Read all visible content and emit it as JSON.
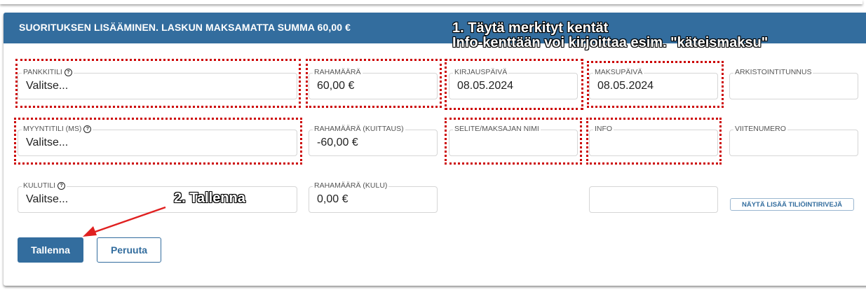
{
  "header": {
    "title": "SUORITUKSEN LISÄÄMINEN. LASKUN MAKSAMATTA SUMMA 60,00 €"
  },
  "annotations": {
    "step1_line1": "1. Täytä merkityt kentät",
    "step1_line2": "Info-kenttään voi kirjoittaa esim. \"käteismaksu\"",
    "step2": "2. Tallenna"
  },
  "fields": {
    "pankkitili": {
      "label": "PANKKITILI",
      "value": "Valitse..."
    },
    "rahamaara": {
      "label": "RAHAMÄÄRÄ",
      "value": "60,00 €"
    },
    "kirjauspaiva": {
      "label": "KIRJAUSPÄIVÄ",
      "value": "08.05.2024"
    },
    "maksupaiva": {
      "label": "MAKSUPÄIVÄ",
      "value": "08.05.2024"
    },
    "arkistointitunnus": {
      "label": "ARKISTOINTITUNNUS",
      "value": ""
    },
    "myyntitili": {
      "label": "MYYNTITILI (MS)",
      "value": "Valitse..."
    },
    "rahamaara_kuittaus": {
      "label": "RAHAMÄÄRÄ (KUITTAUS)",
      "value": "-60,00 €"
    },
    "selite": {
      "label": "SELITE/MAKSAJAN NIMI",
      "value": ""
    },
    "info": {
      "label": "INFO",
      "value": ""
    },
    "viitenumero": {
      "label": "VIITENUMERO",
      "value": ""
    },
    "kulutili": {
      "label": "KULUTILI",
      "value": "Valitse..."
    },
    "rahamaara_kulu": {
      "label": "RAHAMÄÄRÄ (KULU)",
      "value": "0,00 €"
    },
    "extra": {
      "label": "",
      "value": ""
    }
  },
  "buttons": {
    "save": "Tallenna",
    "cancel": "Peruuta",
    "more_rows": "NÄYTÄ LISÄÄ TILIÖINTIRIVEJÄ"
  },
  "icons": {
    "help": "?"
  },
  "colors": {
    "accent": "#336d9e",
    "highlight": "#cc0000"
  }
}
